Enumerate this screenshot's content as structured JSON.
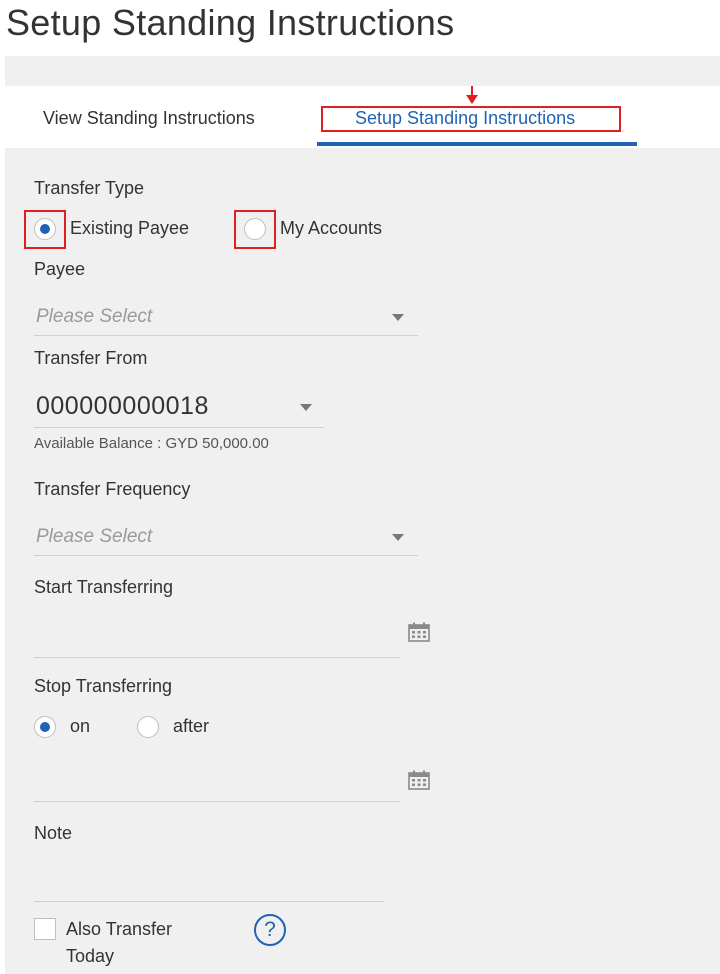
{
  "page": {
    "title": "Setup Standing Instructions"
  },
  "tabs": {
    "view_label": "View Standing Instructions",
    "setup_label": "Setup Standing Instructions"
  },
  "transfer_type": {
    "label": "Transfer Type",
    "options": [
      {
        "label": "Existing Payee",
        "selected": true
      },
      {
        "label": "My Accounts",
        "selected": false
      }
    ]
  },
  "payee": {
    "label": "Payee",
    "placeholder": "Please Select"
  },
  "transfer_from": {
    "label": "Transfer From",
    "value": "000000000018",
    "balance_text": "Available Balance : GYD 50,000.00"
  },
  "transfer_frequency": {
    "label": "Transfer Frequency",
    "placeholder": "Please Select"
  },
  "start_transferring": {
    "label": "Start Transferring",
    "icon": "calendar-icon"
  },
  "stop_transferring": {
    "label": "Stop Transferring",
    "options": [
      {
        "label": "on",
        "selected": true
      },
      {
        "label": "after",
        "selected": false
      }
    ],
    "icon": "calendar-icon"
  },
  "note": {
    "label": "Note"
  },
  "also_transfer": {
    "label": "Also Transfer Today",
    "checked": false,
    "help_icon": "question-circle-icon"
  },
  "colors": {
    "accent": "#1f63b5",
    "annotation": "#e02020",
    "panel": "#f1f0f1"
  }
}
